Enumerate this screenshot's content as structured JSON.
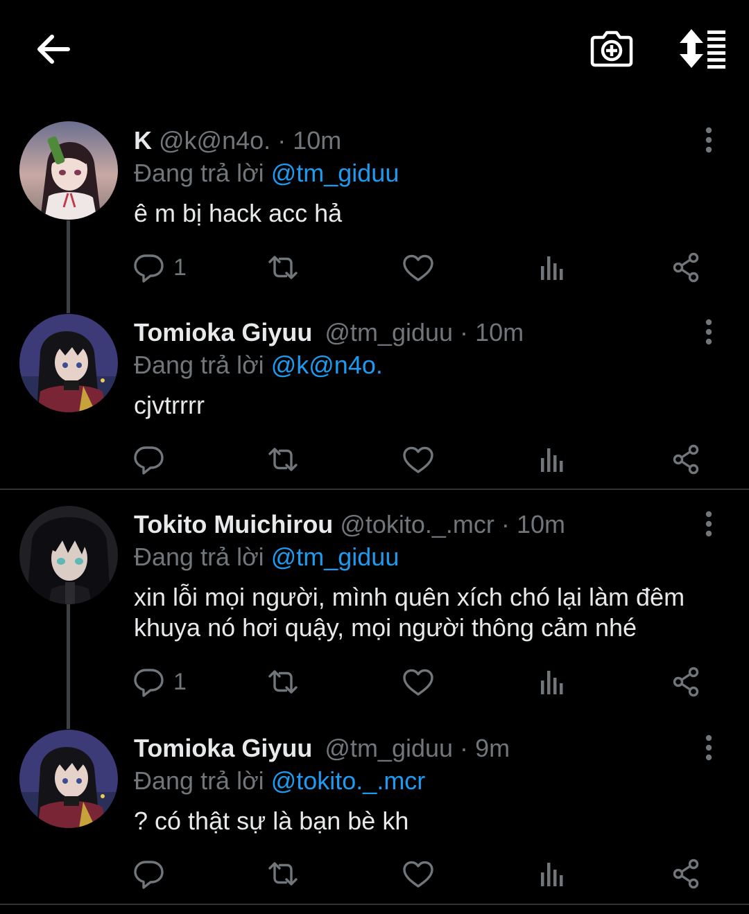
{
  "colors": {
    "background": "#000000",
    "text": "#e7e9ea",
    "muted": "#71767b",
    "accent": "#1d9bf0",
    "line": "#2f3336"
  },
  "topbar": {
    "back_icon": "arrow-left-icon",
    "camera_icon": "camera-add-icon",
    "sort_icon": "sort-icon"
  },
  "tweets": [
    {
      "name": "K",
      "handle": "@k@n4o.",
      "separator": "·",
      "time": "10m",
      "replying_prefix": "Đang trả lời",
      "replying_to": "@tm_giduu",
      "text": "ê m bị hack acc hả",
      "reply_count": "1"
    },
    {
      "name": "Tomioka Giyuu",
      "handle": "@tm_giduu",
      "separator": "·",
      "time": "10m",
      "replying_prefix": "Đang trả lời",
      "replying_to": "@k@n4o.",
      "text": "cjvtrrrr",
      "reply_count": ""
    },
    {
      "name": "Tokito Muichirou",
      "handle": "@tokito._.mcr",
      "separator": "·",
      "time": "10m",
      "replying_prefix": "Đang trả lời",
      "replying_to": "@tm_giduu",
      "text_line1": "xin lỗi mọi người, mình quên xích chó lại làm đêm",
      "text_line2": "khuya nó hơi quậy, mọi người thông cảm nhé",
      "reply_count": "1"
    },
    {
      "name": "Tomioka Giyuu",
      "handle": "@tm_giduu",
      "separator": "·",
      "time": "9m",
      "replying_prefix": "Đang trả lời",
      "replying_to": "@tokito._.mcr",
      "text": "? có thật sự là bạn bè kh",
      "reply_count": ""
    }
  ]
}
